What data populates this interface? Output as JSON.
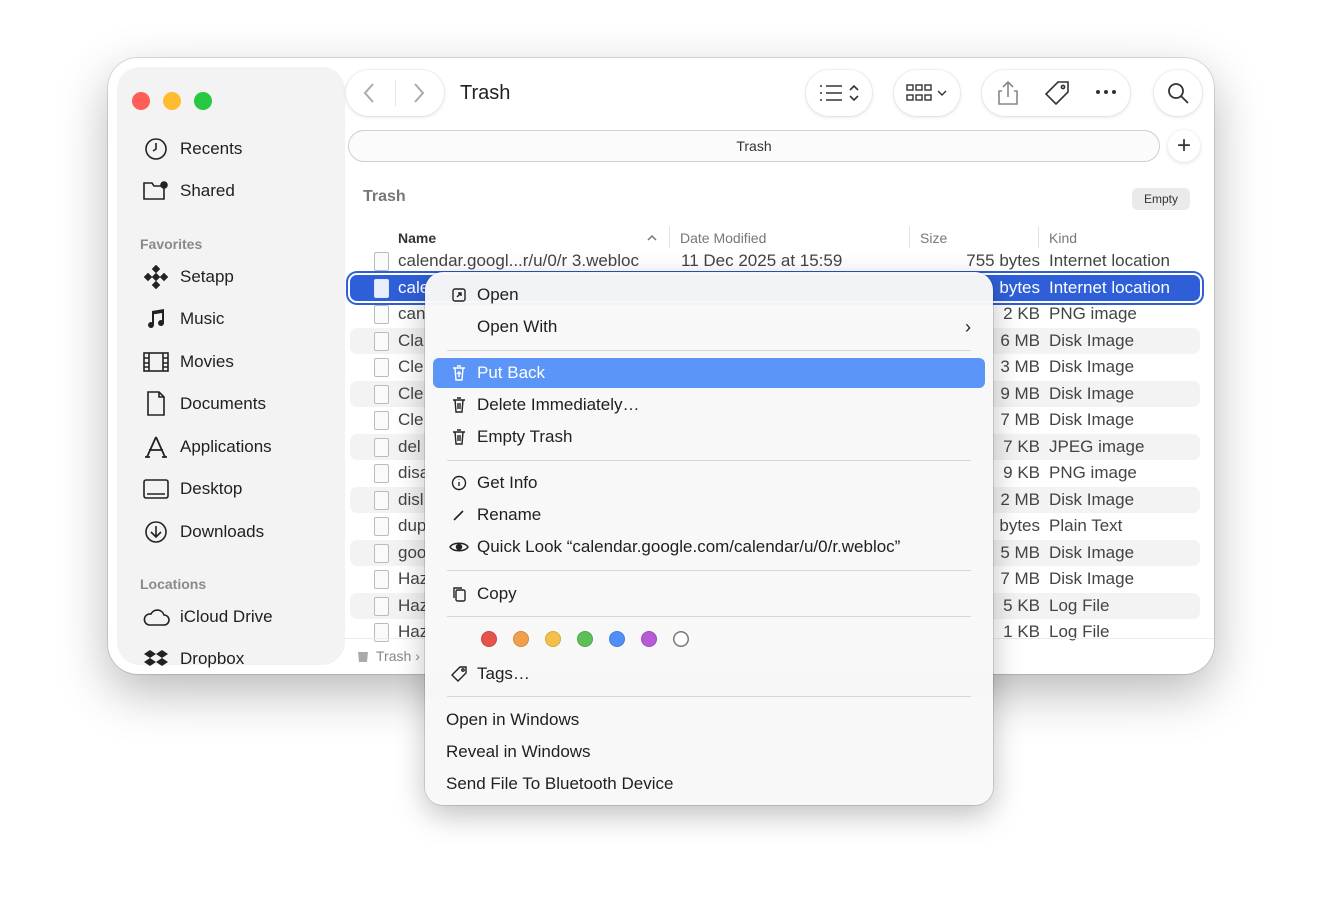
{
  "window": {
    "title": "Trash",
    "tab_label": "Trash",
    "section_title": "Trash",
    "empty_button": "Empty",
    "breadcrumb": "Trash",
    "breadcrumb_arrow": "›"
  },
  "sidebar": {
    "items_top": [
      {
        "label": "Recents",
        "icon": "clock-icon"
      },
      {
        "label": "Shared",
        "icon": "shared-folder-icon"
      }
    ],
    "favorites_heading": "Favorites",
    "favorites": [
      {
        "label": "Setapp",
        "icon": "setapp-icon"
      },
      {
        "label": "Music",
        "icon": "music-note-icon"
      },
      {
        "label": "Movies",
        "icon": "film-icon"
      },
      {
        "label": "Documents",
        "icon": "document-icon"
      },
      {
        "label": "Applications",
        "icon": "applications-icon"
      },
      {
        "label": "Desktop",
        "icon": "desktop-icon"
      },
      {
        "label": "Downloads",
        "icon": "download-icon"
      }
    ],
    "locations_heading": "Locations",
    "locations": [
      {
        "label": "iCloud Drive",
        "icon": "cloud-icon"
      },
      {
        "label": "Dropbox",
        "icon": "dropbox-icon"
      }
    ]
  },
  "columns": {
    "name": "Name",
    "date": "Date Modified",
    "size": "Size",
    "kind": "Kind",
    "sort_indicator": "^"
  },
  "rows": [
    {
      "name": "calendar.googl...r/u/0/r 3.webloc",
      "date": "11 Dec 2025 at 15:59",
      "size": "755 bytes",
      "kind": "Internet location"
    },
    {
      "name": "cale",
      "date": "",
      "size": "bytes",
      "kind": "Internet location",
      "selected": true
    },
    {
      "name": "can",
      "date": "",
      "size": "2 KB",
      "kind": "PNG image"
    },
    {
      "name": "Cla",
      "date": "",
      "size": "6 MB",
      "kind": "Disk Image"
    },
    {
      "name": "Cle",
      "date": "",
      "size": "3 MB",
      "kind": "Disk Image"
    },
    {
      "name": "Cle",
      "date": "",
      "size": "9 MB",
      "kind": "Disk Image"
    },
    {
      "name": "Cle",
      "date": "",
      "size": "7 MB",
      "kind": "Disk Image"
    },
    {
      "name": "del",
      "date": "",
      "size": "7 KB",
      "kind": "JPEG image"
    },
    {
      "name": "disa",
      "date": "",
      "size": "9 KB",
      "kind": "PNG image"
    },
    {
      "name": "disl",
      "date": "",
      "size": "2 MB",
      "kind": "Disk Image"
    },
    {
      "name": "dup",
      "date": "",
      "size": "bytes",
      "kind": "Plain Text"
    },
    {
      "name": "goo",
      "date": "",
      "size": "5 MB",
      "kind": "Disk Image"
    },
    {
      "name": "Haz",
      "date": "",
      "size": "7 MB",
      "kind": "Disk Image"
    },
    {
      "name": "Haz",
      "date": "",
      "size": "5 KB",
      "kind": "Log File"
    },
    {
      "name": "Haz",
      "date": "",
      "size": "1 KB",
      "kind": "Log File"
    }
  ],
  "context_menu": {
    "open": "Open",
    "open_with": "Open With",
    "put_back": "Put Back",
    "delete_immediately": "Delete Immediately…",
    "empty_trash": "Empty Trash",
    "get_info": "Get Info",
    "rename": "Rename",
    "quick_look": "Quick Look “calendar.google.com/calendar/u/0/r.webloc”",
    "copy": "Copy",
    "tags": "Tags…",
    "open_in_windows": "Open in Windows",
    "reveal_in_windows": "Reveal in Windows",
    "send_bluetooth": "Send File To Bluetooth Device",
    "submenu_arrow": "›",
    "tag_colors": [
      "#e5534b",
      "#f0a04b",
      "#f4c04a",
      "#5cbf5a",
      "#4f8ff7",
      "#b65ad6",
      "#ffffff"
    ]
  }
}
